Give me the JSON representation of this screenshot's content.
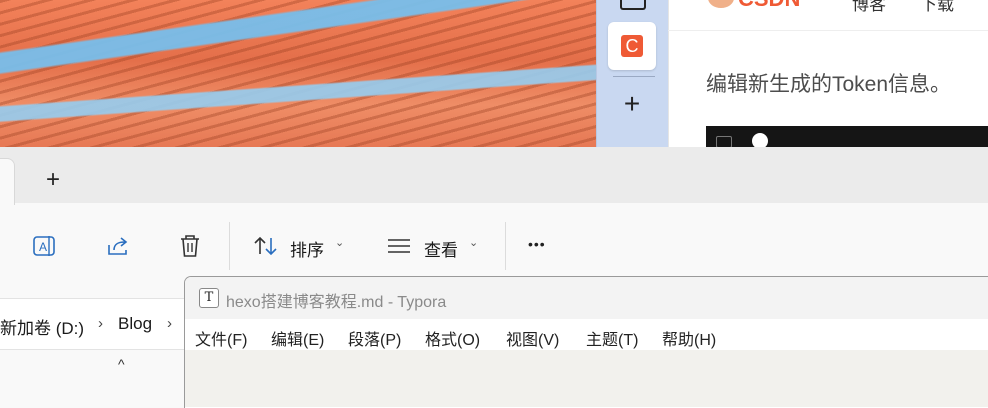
{
  "browser": {
    "csdn_logo": "CSDN",
    "nav": [
      "博客",
      "下载"
    ],
    "article_text": "编辑新生成的Token信息。"
  },
  "sidebar": {
    "app_icon": "csdn-c-icon",
    "app_glyph": "C",
    "add_glyph": "+"
  },
  "explorer": {
    "new_tab_glyph": "+",
    "toolbar": {
      "sort_label": "排序",
      "view_label": "查看",
      "more_glyph": "•••",
      "chevron": "⌄"
    },
    "breadcrumb": {
      "drive": "新加卷 (D:)",
      "folder": "Blog",
      "separator": "›"
    },
    "collapse_glyph": "^"
  },
  "typora": {
    "logo_glyph": "T",
    "title": "hexo搭建博客教程.md - Typora",
    "menu": [
      "文件(F)",
      "编辑(E)",
      "段落(P)",
      "格式(O)",
      "视图(V)",
      "主题(T)",
      "帮助(H)"
    ]
  }
}
